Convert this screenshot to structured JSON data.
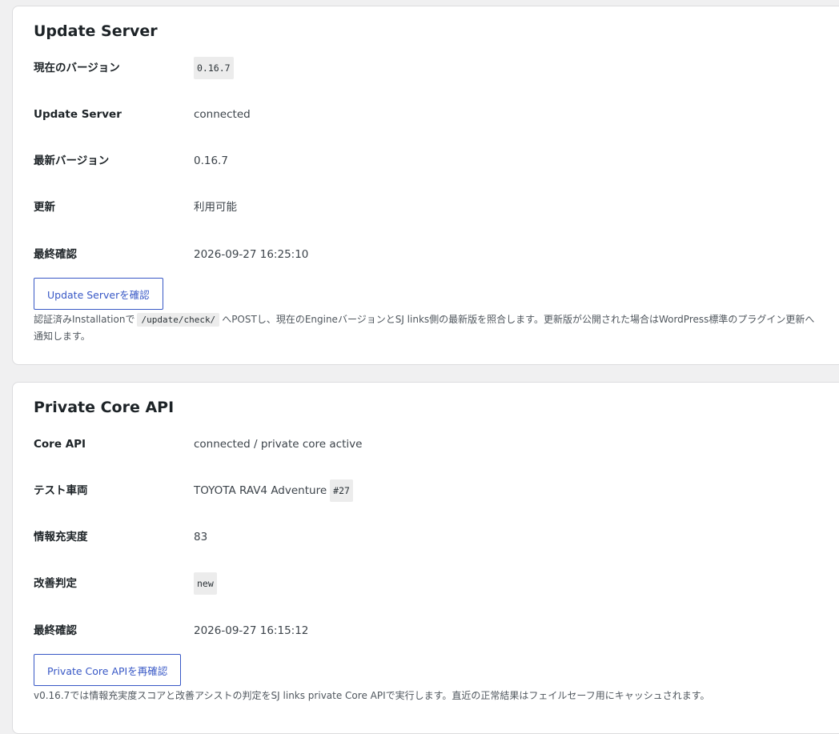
{
  "update_server": {
    "title": "Update Server",
    "rows": [
      {
        "label": "現在のバージョン",
        "value": "0.16.7"
      },
      {
        "label": "Update Server",
        "value": "connected"
      },
      {
        "label": "最新バージョン",
        "value": "0.16.7"
      },
      {
        "label": "更新",
        "value": "利用可能"
      },
      {
        "label": "最終確認",
        "value": "2026-09-27 16:25:10"
      }
    ],
    "button_label": "Update Serverを確認",
    "description": {
      "before": "認証済みInstallationで",
      "code": "/update/check/",
      "after": "へPOSTし、現在のEngineバージョンとSJ links側の最新版を照合します。更新版が公開された場合はWordPress標準のプラグイン更新へ通知します。"
    }
  },
  "private_core": {
    "title": "Private Core API",
    "rows": [
      {
        "label": "Core API",
        "value": "connected / private core active"
      },
      {
        "label": "テスト車両",
        "value": "TOYOTA RAV4 Adventure",
        "badge": "#27"
      },
      {
        "label": "情報充実度",
        "value": "83"
      },
      {
        "label": "改善判定",
        "value": "new"
      },
      {
        "label": "最終確認",
        "value": "2026-09-27 16:15:12"
      }
    ],
    "button_label": "Private Core APIを再確認",
    "description": "v0.16.7では情報充実度スコアと改善アシストの判定をSJ links private Core APIで実行します。直近の正常結果はフェイルセーフ用にキャッシュされます。"
  }
}
